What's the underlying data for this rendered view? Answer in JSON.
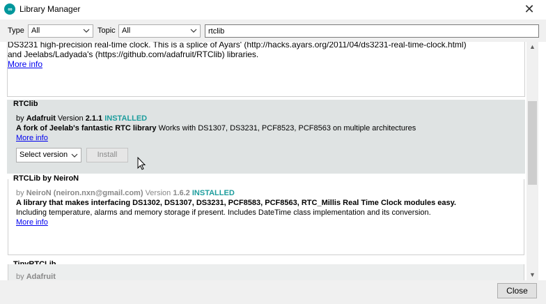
{
  "window": {
    "title": "Library Manager",
    "icon": "arduino-icon"
  },
  "filters": {
    "type_label": "Type",
    "type_value": "All",
    "topic_label": "Topic",
    "topic_value": "All",
    "search_value": "rtclib"
  },
  "entries": [
    {
      "partial_line1": "DS3231 high-precision real-time clock. This is a splice of Ayars' (http://hacks.ayars.org/2011/04/ds3231-real-time-clock.html)",
      "partial_line2": "and Jeelabs/Ladyada's (https://github.com/adafruit/RTClib) libraries.",
      "more_info": "More info"
    },
    {
      "name": "RTClib",
      "by": "by",
      "author": "Adafruit",
      "version_label": "Version",
      "version": "2.1.1",
      "status": "INSTALLED",
      "desc_bold": "A fork of Jeelab's fantastic RTC library",
      "desc_rest": "Works with DS1307, DS3231, PCF8523, PCF8563 on multiple architectures",
      "more_info": "More info",
      "select_version": "Select version",
      "install": "Install"
    },
    {
      "name": "RTCLib by NeiroN",
      "by": "by",
      "author": "NeiroN (neiron.nxn@gmail.com)",
      "version_label": "Version",
      "version": "1.6.2",
      "status": "INSTALLED",
      "desc_bold": "A library that makes interfacing DS1302, DS1307, DS3231, PCF8583, PCF8563, RTC_Millis Real Time Clock modules easy.",
      "desc_rest": "Including temperature, alarms and memory storage if present. Includes DateTime class implementation and its conversion.",
      "more_info": "More info"
    },
    {
      "name": "TinyRTCLib",
      "by": "by",
      "author": "Adafruit"
    }
  ],
  "footer": {
    "close_label": "Close"
  }
}
